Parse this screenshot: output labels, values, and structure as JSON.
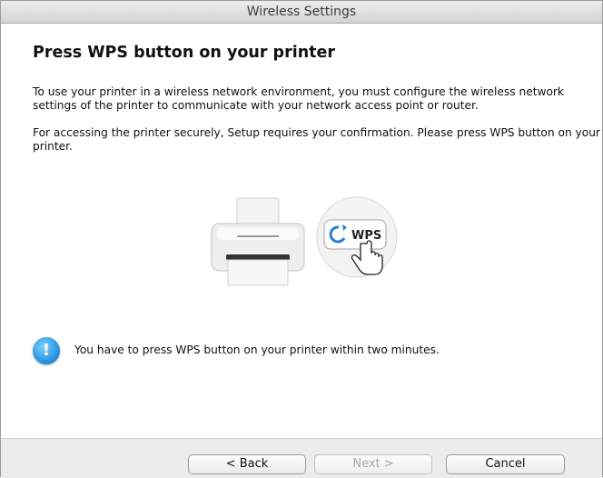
{
  "window": {
    "title": "Wireless Settings"
  },
  "main": {
    "heading": "Press WPS button on your printer",
    "paragraph1": "To use your printer in a wireless network environment, you must configure the wireless network settings of the printer to communicate with your network access point or router.",
    "paragraph2": "For accessing the printer securely, Setup requires your confirmation. Please press WPS button on your printer.",
    "illustration": {
      "wps_label": "WPS",
      "icons": [
        "printer-icon",
        "wps-button-icon",
        "hand-cursor-icon"
      ]
    },
    "notice": {
      "icon": "info-icon",
      "icon_glyph": "!",
      "text": "You have to press WPS button on your printer within two minutes."
    }
  },
  "footer": {
    "back_label": "< Back",
    "next_label": "Next >",
    "cancel_label": "Cancel"
  },
  "colors": {
    "info_blue": "#1f8ddc",
    "wps_blue": "#2a7fd0"
  }
}
